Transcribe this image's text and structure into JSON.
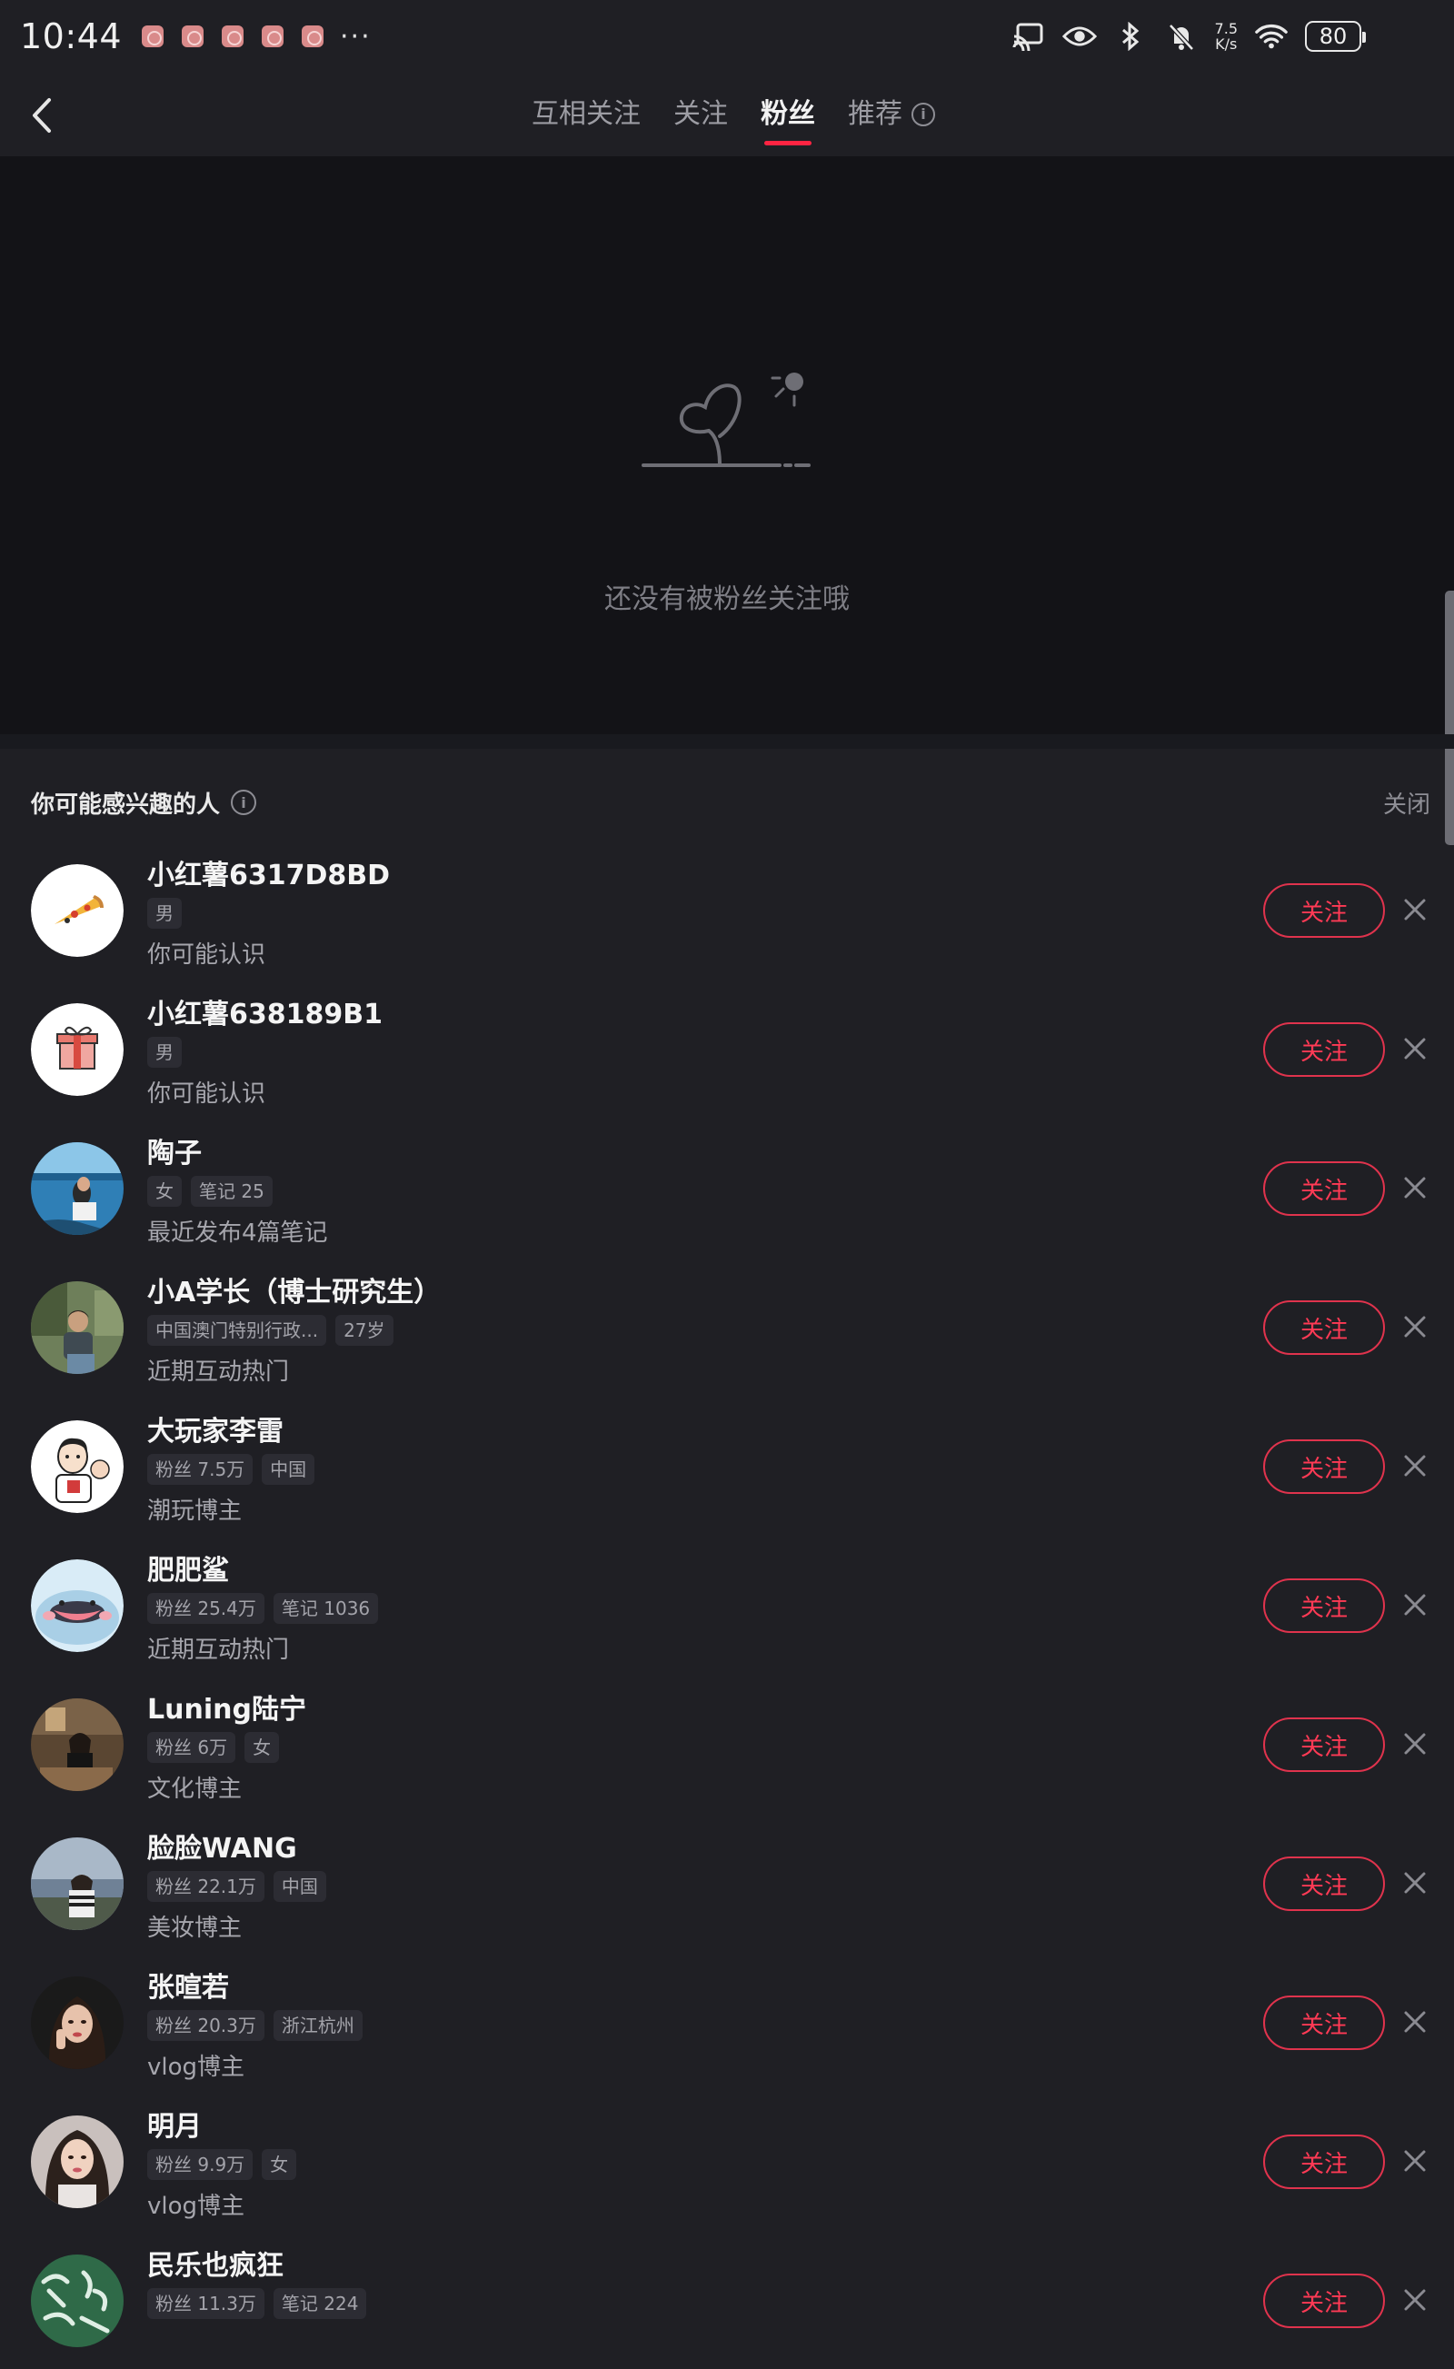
{
  "status_bar": {
    "time": "10:44",
    "more": "···",
    "speed_value": "7.5",
    "speed_unit": "K/s",
    "battery": "80"
  },
  "nav": {
    "tabs": [
      {
        "label": "互相关注",
        "active": false
      },
      {
        "label": "关注",
        "active": false
      },
      {
        "label": "粉丝",
        "active": true
      },
      {
        "label": "推荐",
        "active": false
      }
    ]
  },
  "empty_state": {
    "message": "还没有被粉丝关注哦"
  },
  "suggestions": {
    "title": "你可能感兴趣的人",
    "close_label": "关闭",
    "follow_label": "关注",
    "people": [
      {
        "name": "小红薯6317D8BD",
        "tags": [
          "男"
        ],
        "desc": "你可能认识",
        "avatar": "pizza-avatar"
      },
      {
        "name": "小红薯638189B1",
        "tags": [
          "男"
        ],
        "desc": "你可能认识",
        "avatar": "gift-avatar"
      },
      {
        "name": "陶子",
        "tags": [
          "女",
          "笔记 25"
        ],
        "desc": "最近发布4篇笔记",
        "avatar": "sea-photo-avatar"
      },
      {
        "name": "小A学长（博士研究生）",
        "tags": [
          "中国澳门特别行政...",
          "27岁"
        ],
        "desc": "近期互动热门",
        "avatar": "student-photo-avatar"
      },
      {
        "name": "大玩家李雷",
        "tags": [
          "粉丝 7.5万",
          "中国"
        ],
        "desc": "潮玩博主",
        "avatar": "cartoon-avatar"
      },
      {
        "name": "肥肥鲨",
        "tags": [
          "粉丝 25.4万",
          "笔记 1036"
        ],
        "desc": "近期互动热门",
        "avatar": "shark-avatar"
      },
      {
        "name": "Luning陆宁",
        "tags": [
          "粉丝 6万",
          "女"
        ],
        "desc": "文化博主",
        "avatar": "room-photo-avatar"
      },
      {
        "name": "脸脸WANG",
        "tags": [
          "粉丝 22.1万",
          "中国"
        ],
        "desc": "美妆博主",
        "avatar": "coast-photo-avatar"
      },
      {
        "name": "张暄若",
        "tags": [
          "粉丝 20.3万",
          "浙江杭州"
        ],
        "desc": "vlog博主",
        "avatar": "portrait-photo-avatar"
      },
      {
        "name": "明月",
        "tags": [
          "粉丝 9.9万",
          "女"
        ],
        "desc": "vlog博主",
        "avatar": "selfie-photo-avatar"
      },
      {
        "name": "民乐也疯狂",
        "tags": [
          "粉丝 11.3万",
          "笔记 224"
        ],
        "desc": "",
        "avatar": "calligraphy-avatar"
      }
    ]
  },
  "colors": {
    "accent": "#ff2442",
    "background": "#1f1f24",
    "empty_background": "#131317"
  }
}
